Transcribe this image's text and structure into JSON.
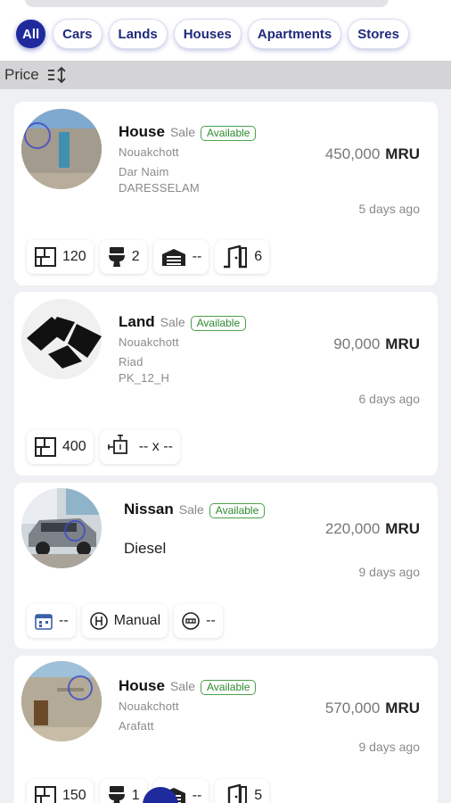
{
  "filters": [
    {
      "label": "All",
      "active": true
    },
    {
      "label": "Cars",
      "active": false
    },
    {
      "label": "Lands",
      "active": false
    },
    {
      "label": "Houses",
      "active": false
    },
    {
      "label": "Apartments",
      "active": false
    },
    {
      "label": "Stores",
      "active": false
    }
  ],
  "sort": {
    "label": "Price",
    "icon": "sort-icon"
  },
  "listings": [
    {
      "title": "House",
      "deal": "Sale",
      "status": "Available",
      "city": "Nouakchott",
      "district": "Dar Naim",
      "area": "DARESSELAM",
      "price": "450,000",
      "currency": "MRU",
      "posted": "5 days ago",
      "features": [
        {
          "icon": "floor-plan-icon",
          "value": "120"
        },
        {
          "icon": "toilet-icon",
          "value": "2"
        },
        {
          "icon": "garage-icon",
          "value": "--"
        },
        {
          "icon": "door-icon",
          "value": "6"
        }
      ]
    },
    {
      "title": "Land",
      "deal": "Sale",
      "status": "Available",
      "city": "Nouakchott",
      "district": "Riad",
      "area": "PK_12_H",
      "price": "90,000",
      "currency": "MRU",
      "posted": "6 days ago",
      "features": [
        {
          "icon": "floor-plan-icon",
          "value": "400"
        },
        {
          "icon": "dimensions-icon",
          "value": "-- x --"
        }
      ]
    },
    {
      "title": "Nissan",
      "deal": "Sale",
      "status": "Available",
      "fuel": "Diesel",
      "price": "220,000",
      "currency": "MRU",
      "posted": "9 days ago",
      "features": [
        {
          "icon": "calendar-icon",
          "value": "--"
        },
        {
          "icon": "gearbox-icon",
          "value": "Manual"
        },
        {
          "icon": "odometer-icon",
          "value": "--"
        }
      ]
    },
    {
      "title": "House",
      "deal": "Sale",
      "status": "Available",
      "city": "Nouakchott",
      "district": "Arafatt",
      "price": "570,000",
      "currency": "MRU",
      "posted": "9 days ago",
      "features": [
        {
          "icon": "floor-plan-icon",
          "value": "150"
        },
        {
          "icon": "toilet-icon",
          "value": "1"
        },
        {
          "icon": "garage-icon",
          "value": "--"
        },
        {
          "icon": "door-icon",
          "value": "5"
        }
      ]
    }
  ],
  "colors": {
    "accent": "#1f2a9c",
    "available": "#2e8a2e",
    "background": "#eef0f3"
  }
}
